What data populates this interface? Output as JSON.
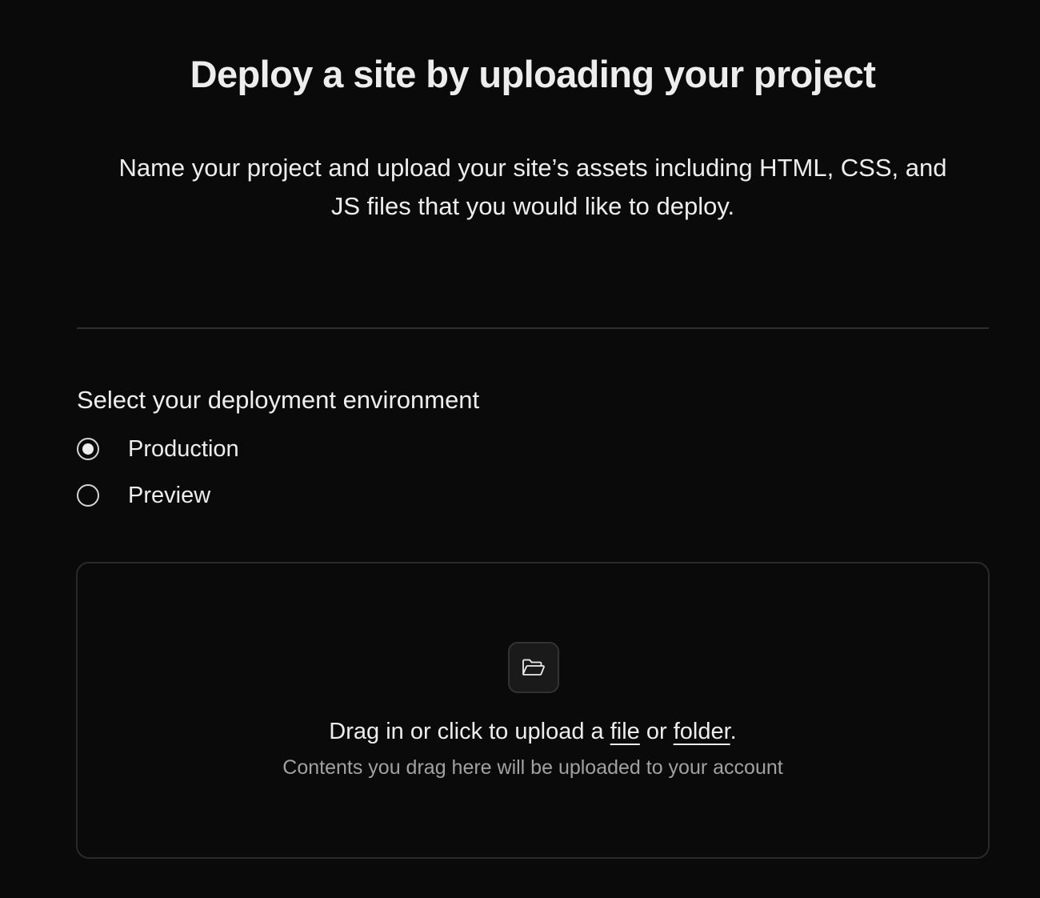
{
  "header": {
    "title": "Deploy a site by uploading your project",
    "subtitle": "Name your project and upload your site’s assets including HTML, CSS, and JS files that you would like to deploy."
  },
  "environment": {
    "heading": "Select your deployment environment",
    "options": [
      {
        "label": "Production",
        "selected": true
      },
      {
        "label": "Preview",
        "selected": false
      }
    ]
  },
  "dropzone": {
    "icon": "folder-open-icon",
    "text_prefix": "Drag in or click to upload a ",
    "file_link": "file",
    "text_middle": " or ",
    "folder_link": "folder",
    "text_suffix": ".",
    "helper": "Contents you drag here will be uploaded to your account"
  },
  "colors": {
    "background": "#0a0a0a",
    "text": "#ededed",
    "muted_text": "#a1a1a1",
    "border": "#2a2a2a"
  }
}
